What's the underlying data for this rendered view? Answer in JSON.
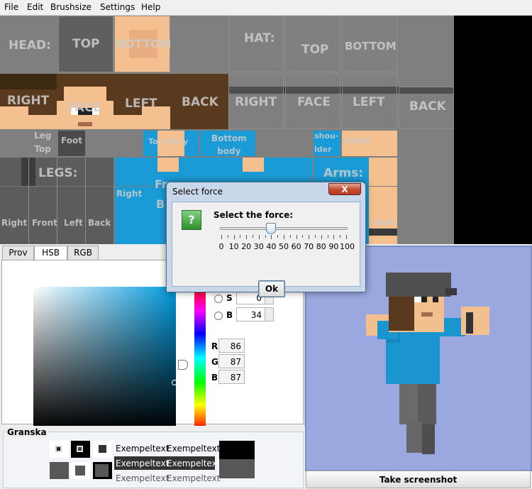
{
  "menu": [
    "File",
    "Edit",
    "Brushsize",
    "Settings",
    "Help"
  ],
  "skin": {
    "head_label": "HEAD:",
    "top": "TOP",
    "bottom": "BOTTOM",
    "hat_label": "HAT:",
    "hat_top": "TOP",
    "hat_bottom": "BOTTOM",
    "right": "RIGHT",
    "face": "FACE",
    "left": "LEFT",
    "back": "BACK",
    "hat_right": "RIGHT",
    "hat_face": "FACE",
    "hat_left": "LEFT",
    "hat_back": "BACK",
    "leg_top": "Leg\nTop",
    "foot": "Foot",
    "top_body": "Top Body",
    "bottom_body": "Bottom\nbody",
    "shoulder": "shou-\nlder",
    "hand": "HAND",
    "legs_label": "LEGS:",
    "leg_right": "Right",
    "leg_front": "Front",
    "leg_left": "Left",
    "leg_back": "Back",
    "body_right": "Right",
    "body_fr": "Fr",
    "body_b": "B",
    "arms_label": "Arms:",
    "arm_back": "Back"
  },
  "chooser": {
    "tabs": [
      "Prov",
      "HSB",
      "RGB"
    ],
    "active_tab": "HSB",
    "s_label": "S",
    "s_value": "0",
    "b_label": "B",
    "b_value": "34",
    "r_label": "R",
    "r_value": "86",
    "g_label": "G",
    "g_value": "87",
    "b2_label": "B",
    "b2_value": "87"
  },
  "preview": {
    "title": "Granska",
    "sample": "Exempeltext",
    "preview_color": "#565757"
  },
  "screenshot_button": "Take screenshot",
  "dialog": {
    "title": "Select force",
    "close": "X",
    "icon": "?",
    "message": "Select the force:",
    "ticks": [
      "0",
      "10",
      "20",
      "30",
      "40",
      "50",
      "60",
      "70",
      "80",
      "90",
      "100"
    ],
    "value": 40,
    "ok": "Ok"
  }
}
